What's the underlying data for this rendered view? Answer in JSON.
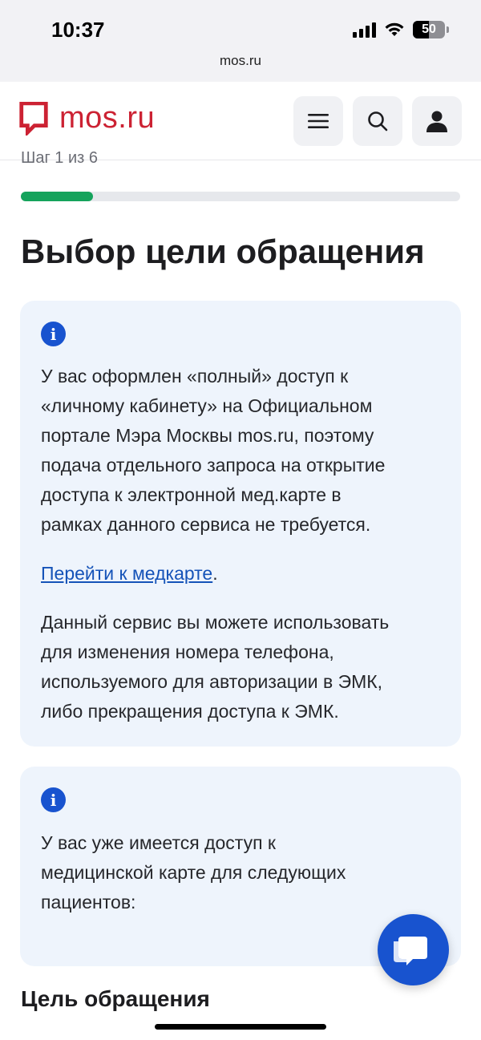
{
  "status_bar": {
    "time": "10:37",
    "battery": "50"
  },
  "browser": {
    "url": "mos.ru"
  },
  "header": {
    "logo_text": "mos.ru",
    "menu_icon": "hamburger-icon",
    "search_icon": "search-icon",
    "profile_icon": "user-icon"
  },
  "step": {
    "label": "Шаг 1 из 6",
    "progress": 0.165
  },
  "page_title": "Выбор цели обращения",
  "card1": {
    "text_lines": [
      "У вас оформлен «полный» доступ к",
      "«личному кабинету» на Официальном",
      "портале Мэра Москвы mos.ru, поэтому",
      "подача отдельного запроса на открытие",
      "доступа к электронной мед.карте в",
      "рамках данного сервиса не требуется."
    ],
    "link_text": "Перейти к медкарте",
    "link_suffix": ".",
    "text2_lines": [
      "Данный сервис вы можете использовать",
      "для изменения номера телефона,",
      "используемого для авторизации в ЭМК,",
      "либо прекращения доступа к ЭМК."
    ]
  },
  "card2": {
    "text_lines": [
      "У вас уже имеется доступ к",
      "медицинской карте для следующих",
      "пациентов:"
    ]
  },
  "section_title": "Цель обращения",
  "colors": {
    "brand_red": "#cc2233",
    "accent_blue": "#1853cf",
    "progress_green": "#15a35c"
  }
}
